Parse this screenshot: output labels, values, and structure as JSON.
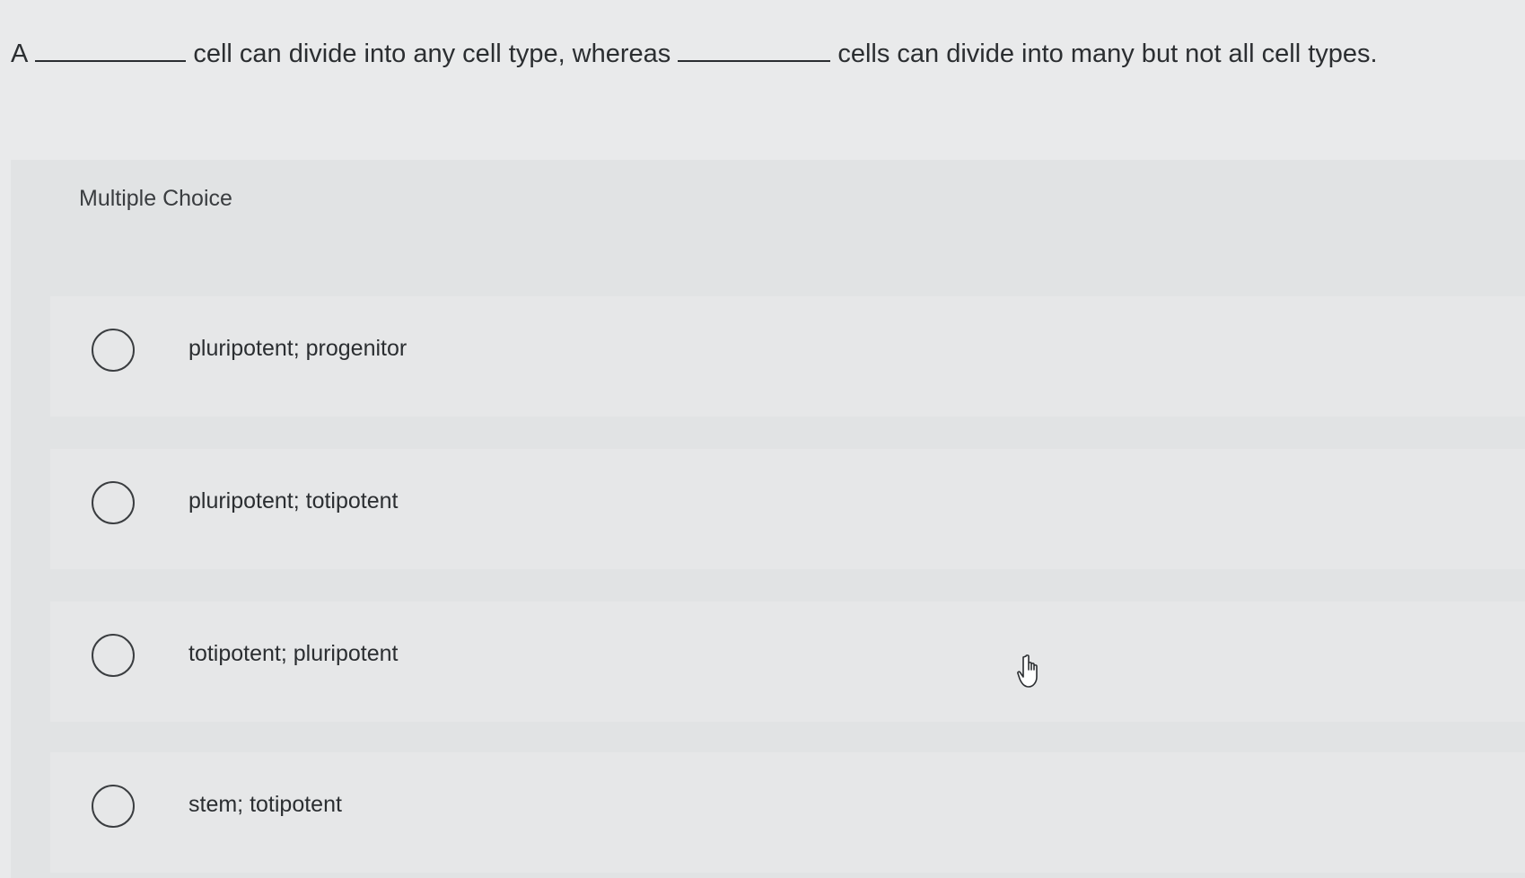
{
  "question": {
    "prefix": "A",
    "middle": "cell can divide into any cell type, whereas",
    "suffix": "cells can divide into many but not all cell types."
  },
  "question_type_label": "Multiple Choice",
  "options": [
    {
      "label": "pluripotent; progenitor",
      "selected": false
    },
    {
      "label": "pluripotent; totipotent",
      "selected": false
    },
    {
      "label": "totipotent; pluripotent",
      "selected": false
    },
    {
      "label": "stem; totipotent",
      "selected": false
    }
  ],
  "cursor": {
    "icon": "hand-pointer-icon"
  }
}
